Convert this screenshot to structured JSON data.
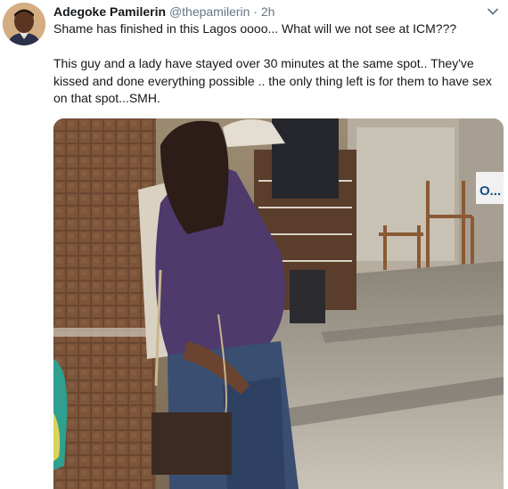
{
  "tweet": {
    "author_name": "Adegoke Pamilerin",
    "handle": "@thepamilerin",
    "separator": "·",
    "time": "2h",
    "text": "Shame has finished in this Lagos oooo... What will we not see at ICM???\n\nThis guy and a lady have stayed over 30 minutes at the same spot.. They've kissed and done everything possible .. the only thing left is for them to have sex on that spot...SMH.",
    "caret_icon": "chevron-down-icon",
    "avatar_icon": "avatar",
    "media": {
      "description": "photo-mall-interior",
      "sign_text": "O..."
    }
  },
  "colors": {
    "text": "#14171a",
    "secondary": "#657786"
  }
}
